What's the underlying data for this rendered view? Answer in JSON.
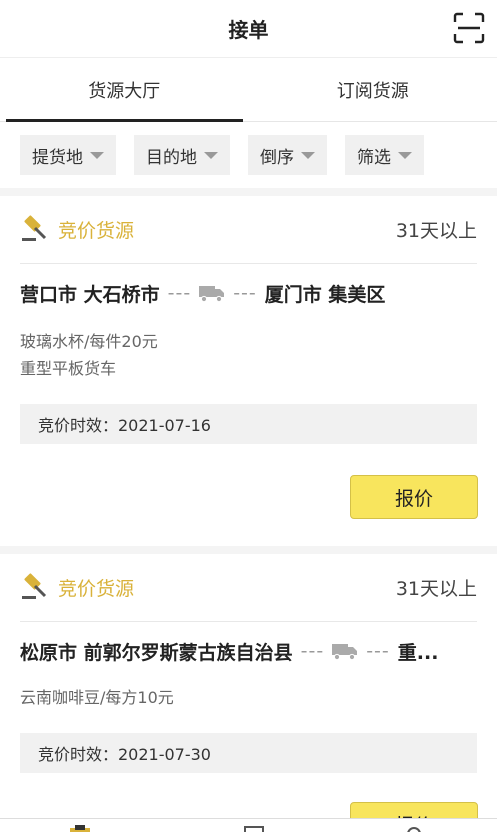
{
  "header": {
    "title": "接单",
    "scan_icon": "scan-icon"
  },
  "tabs": [
    {
      "label": "货源大厅",
      "active": true
    },
    {
      "label": "订阅货源",
      "active": false
    }
  ],
  "filters": [
    {
      "label": "提货地"
    },
    {
      "label": "目的地"
    },
    {
      "label": "倒序"
    },
    {
      "label": "筛选"
    }
  ],
  "colors": {
    "accent": "#d9b23a",
    "button": "#f8e55d",
    "tag_bg": "#f1f1f1"
  },
  "cards": [
    {
      "type_label": "竞价货源",
      "time_label": "31天以上",
      "origin": "营口市 大石桥市",
      "dash": "---",
      "destination": "厦门市 集美区",
      "cargo": "玻璃水杯/每件20元",
      "vehicle": "重型平板货车",
      "expiry": "竞价时效：2021-07-16",
      "quote_label": "报价"
    },
    {
      "type_label": "竞价货源",
      "time_label": "31天以上",
      "origin": "松原市 前郭尔罗斯蒙古族自治县",
      "dash": "---",
      "destination": "重...",
      "cargo": "云南咖啡豆/每方10元",
      "expiry": "竞价时效：2021-07-30",
      "quote_label": "报价"
    }
  ]
}
